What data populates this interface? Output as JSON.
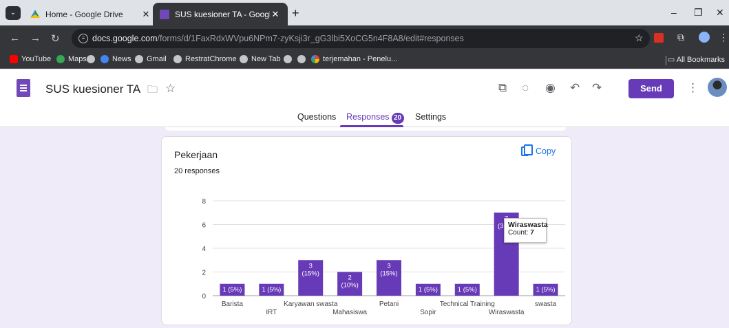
{
  "browser": {
    "tabs": [
      {
        "title": "Home - Google Drive",
        "active": false
      },
      {
        "title": "SUS kuesioner TA - Google Forms",
        "active": true
      }
    ],
    "url_host": "docs.google.com",
    "url_rest": "/forms/d/1FaxRdxWVpu6NPm7-zyKsji3r_gG3lbi5XoCG5n4F8A8/edit#responses",
    "bookmarks": [
      "YouTube",
      "Maps",
      "",
      "News",
      "Gmail",
      "RestratChrome",
      "New Tab",
      "",
      "",
      "terjemahan - Penelu..."
    ],
    "all_bookmarks": "All Bookmarks"
  },
  "forms": {
    "title": "SUS kuesioner TA",
    "send_label": "Send",
    "tabs": {
      "questions": "Questions",
      "responses": "Responses",
      "responses_count": "20",
      "settings": "Settings"
    }
  },
  "card": {
    "question": "Pekerjaan",
    "response_count": "20 responses",
    "copy_label": "Copy"
  },
  "tooltip": {
    "name": "Wiraswasta",
    "count_label": "Count:",
    "count_value": "7"
  },
  "colors": {
    "accent": "#673ab7",
    "bar": "#673ab7",
    "page_bg": "#f0ebf8",
    "link": "#1a73e8"
  },
  "chart_data": {
    "type": "bar",
    "title": "Pekerjaan",
    "categories": [
      "Barista",
      "IRT",
      "Karyawan swasta",
      "Mahasiswa",
      "Petani",
      "Sopir",
      "Technical Training",
      "Wiraswasta",
      "swasta"
    ],
    "values": [
      1,
      1,
      3,
      2,
      3,
      1,
      1,
      7,
      1
    ],
    "labels": [
      "1 (5%)",
      "1 (5%)",
      "3\n(15%)",
      "2\n(10%)",
      "3\n(15%)",
      "1 (5%)",
      "1 (5%)",
      "7\n(35%)",
      "1 (5%)"
    ],
    "yticks": [
      0,
      2,
      4,
      6,
      8
    ],
    "ylim": [
      0,
      8
    ],
    "grid": true,
    "legend": "none"
  }
}
